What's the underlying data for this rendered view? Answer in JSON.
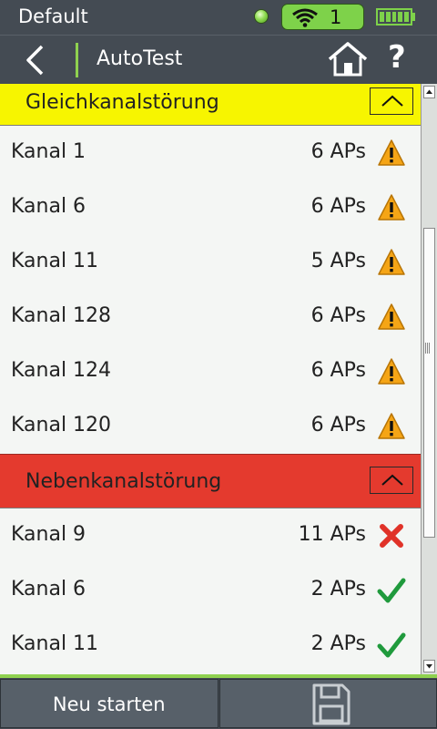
{
  "statusbar": {
    "profile": "Default",
    "wifi_count": "1"
  },
  "navbar": {
    "title": "AutoTest"
  },
  "sections": [
    {
      "title": "Gleichkanalstörung",
      "color": "#f7f500",
      "rows": [
        {
          "name": "Kanal 1",
          "count": "6 APs",
          "status": "warning"
        },
        {
          "name": "Kanal 6",
          "count": "6 APs",
          "status": "warning"
        },
        {
          "name": "Kanal 11",
          "count": "5 APs",
          "status": "warning"
        },
        {
          "name": "Kanal 128",
          "count": "6 APs",
          "status": "warning"
        },
        {
          "name": "Kanal 124",
          "count": "6 APs",
          "status": "warning"
        },
        {
          "name": "Kanal 120",
          "count": "6 APs",
          "status": "warning"
        }
      ]
    },
    {
      "title": "Nebenkanalstörung",
      "color": "#e43a2e",
      "rows": [
        {
          "name": "Kanal 9",
          "count": "11 APs",
          "status": "fail"
        },
        {
          "name": "Kanal 6",
          "count": "2 APs",
          "status": "pass"
        },
        {
          "name": "Kanal 11",
          "count": "2 APs",
          "status": "pass"
        }
      ]
    }
  ],
  "footer": {
    "restart_label": "Neu starten"
  },
  "icons": {
    "warning": "warning-icon",
    "fail": "fail-x-icon",
    "pass": "check-icon",
    "save": "save-disk-icon",
    "home": "home-icon",
    "help": "help-icon",
    "back": "back-chevron-icon"
  }
}
